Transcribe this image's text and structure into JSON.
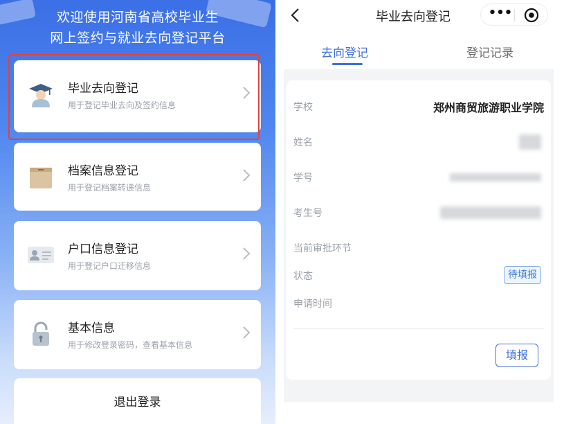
{
  "left": {
    "banner": {
      "line1": "欢迎使用河南省高校毕业生",
      "line2": "网上签约与就业去向登记平台"
    },
    "cards": [
      {
        "title": "毕业去向登记",
        "subtitle": "用于登记毕业去向及签约信息",
        "icon": "graduate-icon"
      },
      {
        "title": "档案信息登记",
        "subtitle": "用于登记档案转递信息",
        "icon": "archive-box-icon"
      },
      {
        "title": "户口信息登记",
        "subtitle": "用于登记户口迁移信息",
        "icon": "id-card-icon"
      },
      {
        "title": "基本信息",
        "subtitle": "用于修改登录密码，查看基本信息",
        "icon": "lock-icon"
      }
    ],
    "logout_label": "退出登录",
    "highlight_color": "#e3413f",
    "arrow_icon": "chevron-right-icon"
  },
  "right": {
    "nav": {
      "back_icon": "chevron-left-icon",
      "title": "毕业去向登记",
      "more_icon": "more-dots-icon",
      "more_text": "•••",
      "close_icon": "target-circle-icon"
    },
    "tabs": [
      {
        "label": "去向登记",
        "active": true
      },
      {
        "label": "登记记录",
        "active": false
      }
    ],
    "fields": {
      "school": {
        "label": "学校",
        "value": "郑州商贸旅游职业学院"
      },
      "name": {
        "label": "姓名"
      },
      "student_id": {
        "label": "学号"
      },
      "exam_id": {
        "label": "考生号"
      },
      "approval_stage": {
        "label": "当前审批环节"
      },
      "status": {
        "label": "状态",
        "value": "待填报"
      },
      "apply_time": {
        "label": "申请时间"
      }
    },
    "fill_button": "填报",
    "accent_color": "#3d6fe0"
  }
}
